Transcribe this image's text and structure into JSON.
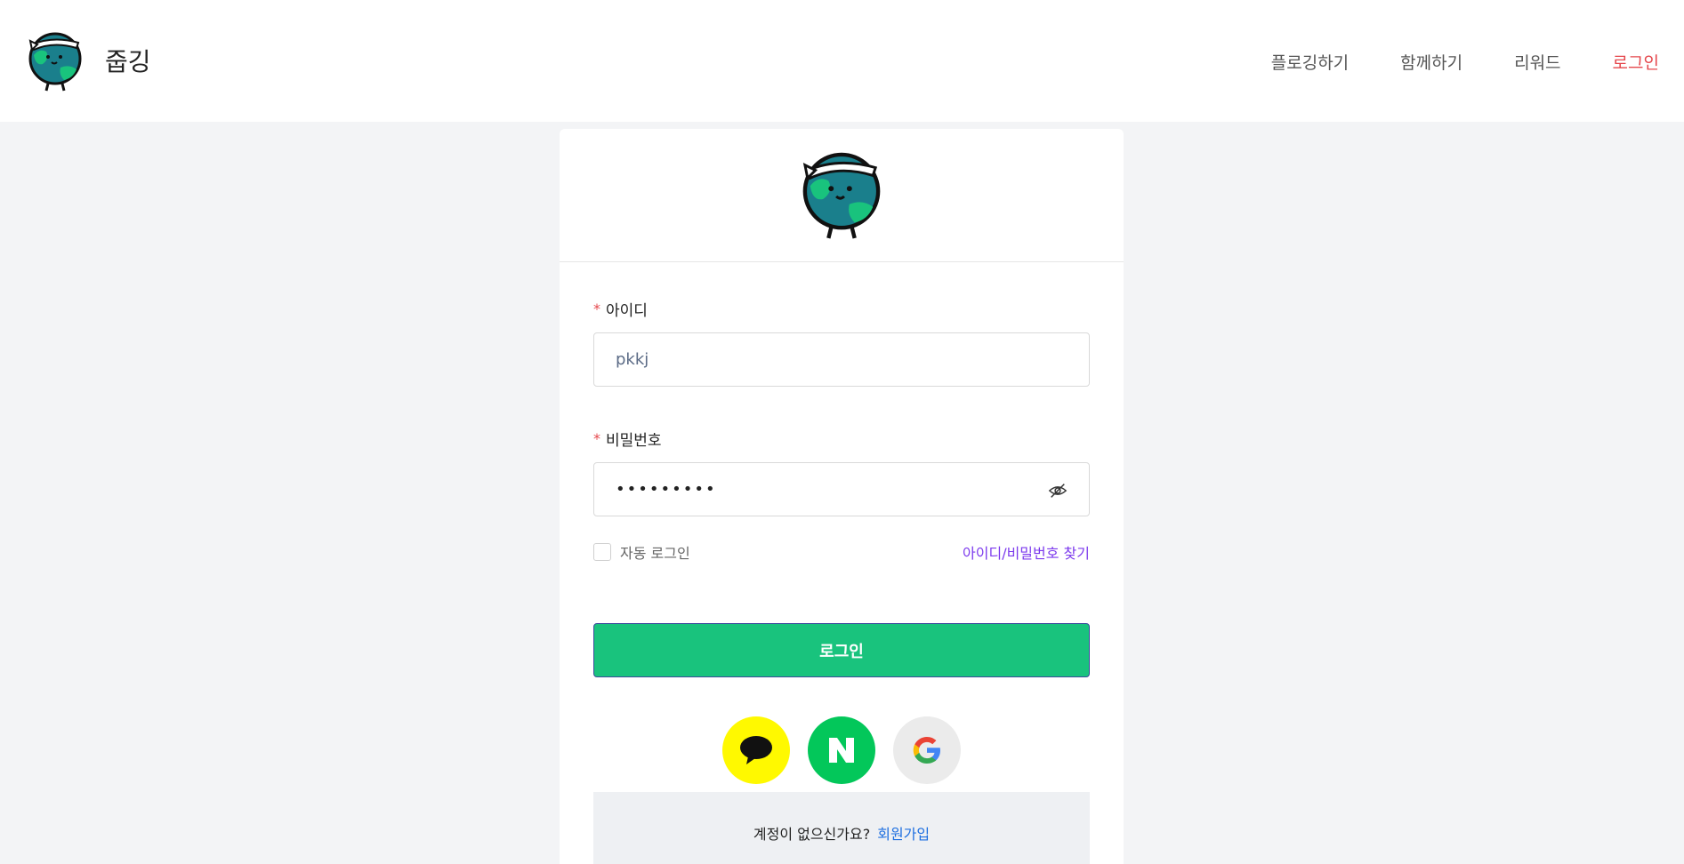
{
  "app": {
    "brand_name": "줍깅"
  },
  "nav": {
    "items": [
      {
        "label": "플로깅하기",
        "active": false
      },
      {
        "label": "함께하기",
        "active": false
      },
      {
        "label": "리워드",
        "active": false
      },
      {
        "label": "로그인",
        "active": true
      }
    ]
  },
  "form": {
    "id_label": "아이디",
    "id_value": "pkkj",
    "password_label": "비밀번호",
    "password_value": "•••••••••",
    "required_mark": "*",
    "auto_login_label": "자동 로그인",
    "auto_login_checked": false,
    "find_account_label": "아이디/비밀번호 찾기",
    "login_button_label": "로그인"
  },
  "social": {
    "providers": [
      "kakao",
      "naver",
      "google"
    ],
    "naver_letter": "N"
  },
  "signup": {
    "prompt": "계정이 없으신가요?",
    "link_label": "회원가입"
  },
  "colors": {
    "accent_green": "#19c37d",
    "active_nav": "#e5484d",
    "link_purple": "#7c3aed",
    "link_blue": "#1e6fe0",
    "kakao_yellow": "#fff900",
    "naver_green": "#03c75a"
  },
  "icons": {
    "logo": "earth-mascot-icon",
    "password_toggle": "eye-off-icon",
    "kakao": "kakao-speech-bubble-icon",
    "naver": "naver-n-icon",
    "google": "google-g-icon"
  }
}
